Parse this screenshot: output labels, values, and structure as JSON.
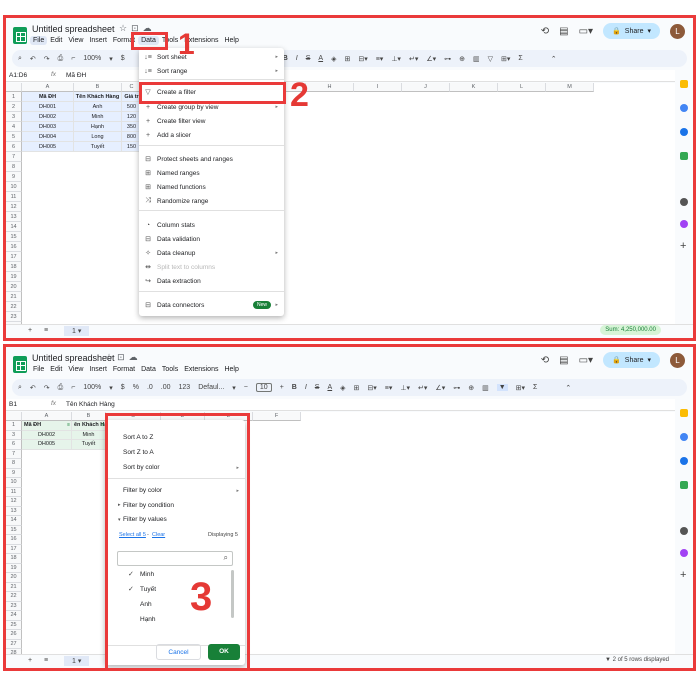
{
  "top": {
    "title": "Untitled spreadsheet",
    "menu": [
      "File",
      "Edit",
      "View",
      "Insert",
      "Format",
      "Data",
      "Tools",
      "Extensions",
      "Help"
    ],
    "share": "Share",
    "avatar": "L",
    "zoom": "100%",
    "currency": "$",
    "name_box": "A1:D6",
    "formula": "Mã ĐH",
    "columns": [
      "A",
      "B",
      "C",
      "D",
      "E",
      "F",
      "G",
      "H",
      "I",
      "J",
      "K",
      "L",
      "M"
    ],
    "table": {
      "headers": [
        "Mã ĐH",
        "Tên Khách Hàng",
        "Giá tr"
      ],
      "rows": [
        [
          "DH001",
          "Anh",
          "500"
        ],
        [
          "DH002",
          "Minh",
          "120"
        ],
        [
          "DH003",
          "Hạnh",
          "350"
        ],
        [
          "DH004",
          "Long",
          "800"
        ],
        [
          "DH005",
          "Tuyết",
          "150"
        ]
      ]
    },
    "row_numbers": [
      "1",
      "2",
      "3",
      "4",
      "5",
      "6",
      "7",
      "8",
      "9",
      "10",
      "11",
      "12",
      "13",
      "14",
      "15",
      "16",
      "17",
      "18",
      "19",
      "20",
      "21",
      "22",
      "23",
      "24",
      "25"
    ],
    "data_menu": {
      "items": [
        {
          "icon": "sort-icon",
          "glyph": "↓≡",
          "label": "Sort sheet",
          "submenu": true
        },
        {
          "icon": "sort-range-icon",
          "glyph": "↓≡",
          "label": "Sort range",
          "submenu": true
        },
        {
          "icon": "filter-icon",
          "glyph": "▽",
          "label": "Create a filter"
        },
        {
          "icon": "group-icon",
          "glyph": "+",
          "label": "Create group by view",
          "submenu": true
        },
        {
          "icon": "filter-view-icon",
          "glyph": "+",
          "label": "Create filter view"
        },
        {
          "icon": "slicer-icon",
          "glyph": "+",
          "label": "Add a slicer"
        },
        {
          "icon": "protect-icon",
          "glyph": "⊟",
          "label": "Protect sheets and ranges"
        },
        {
          "icon": "named-range-icon",
          "glyph": "⊞",
          "label": "Named ranges"
        },
        {
          "icon": "named-function-icon",
          "glyph": "⊞",
          "label": "Named functions"
        },
        {
          "icon": "randomize-icon",
          "glyph": "⤨",
          "label": "Randomize range"
        },
        {
          "icon": "stats-icon",
          "glyph": "◔",
          "label": "Column stats"
        },
        {
          "icon": "validation-icon",
          "glyph": "⊟",
          "label": "Data validation"
        },
        {
          "icon": "cleanup-icon",
          "glyph": "✧",
          "label": "Data cleanup",
          "submenu": true
        },
        {
          "icon": "split-icon",
          "glyph": "⇹",
          "label": "Split text to columns",
          "disabled": true
        },
        {
          "icon": "extraction-icon",
          "glyph": "↪",
          "label": "Data extraction"
        },
        {
          "icon": "connectors-icon",
          "glyph": "⊟",
          "label": "Data connectors",
          "badge": "New",
          "submenu": true
        }
      ]
    },
    "sum_label": "Sum: 4,250,000.00",
    "step_labels": [
      "1",
      "2"
    ]
  },
  "bottom": {
    "title": "Untitled spreadsheet",
    "menu": [
      "File",
      "Edit",
      "View",
      "Insert",
      "Format",
      "Data",
      "Tools",
      "Extensions",
      "Help"
    ],
    "share": "Share",
    "avatar": "L",
    "zoom": "100%",
    "currency": "$",
    "percent": "%",
    "number_format": "123",
    "font": "Defaul...",
    "font_size": "10",
    "name_box": "B1",
    "formula": "Tên Khách Hàng",
    "columns": [
      "A",
      "B",
      "C",
      "D",
      "E",
      "F"
    ],
    "table": {
      "headers": [
        "Mã ĐH",
        "ên Khách Hà",
        "Giá trị (VNĐ)",
        "Trạng Thái"
      ],
      "rows": [
        {
          "n": "3",
          "cells": [
            "DH002",
            "Minh"
          ]
        },
        {
          "n": "6",
          "cells": [
            "DH005",
            "Tuyết"
          ]
        }
      ]
    },
    "row_numbers": [
      "1",
      "3",
      "6",
      "7",
      "8",
      "9",
      "10",
      "11",
      "12",
      "13",
      "14",
      "15",
      "16",
      "17",
      "18",
      "19",
      "20",
      "21",
      "22",
      "23",
      "24",
      "25",
      "26",
      "27",
      "28",
      "29"
    ],
    "filter_menu": {
      "sort_az": "Sort A to Z",
      "sort_za": "Sort Z to A",
      "sort_color": "Sort by color",
      "filter_color": "Filter by color",
      "filter_condition": "Filter by condition",
      "filter_values": "Filter by values",
      "select_all": "Select all 5",
      "clear": "Clear",
      "displaying": "Displaying 5",
      "values": [
        {
          "label": "Minh",
          "checked": true
        },
        {
          "label": "Tuyết",
          "checked": true
        },
        {
          "label": "Anh",
          "checked": false
        },
        {
          "label": "Hạnh",
          "checked": false
        }
      ],
      "cancel": "Cancel",
      "ok": "OK"
    },
    "status": "2 of 5 rows displayed",
    "step_label": "3"
  },
  "colors": {
    "accent_red": "#ea3a3a",
    "sheets_green": "#0f9d58",
    "share_bg": "#c2e7ff",
    "ok_green": "#188038"
  }
}
